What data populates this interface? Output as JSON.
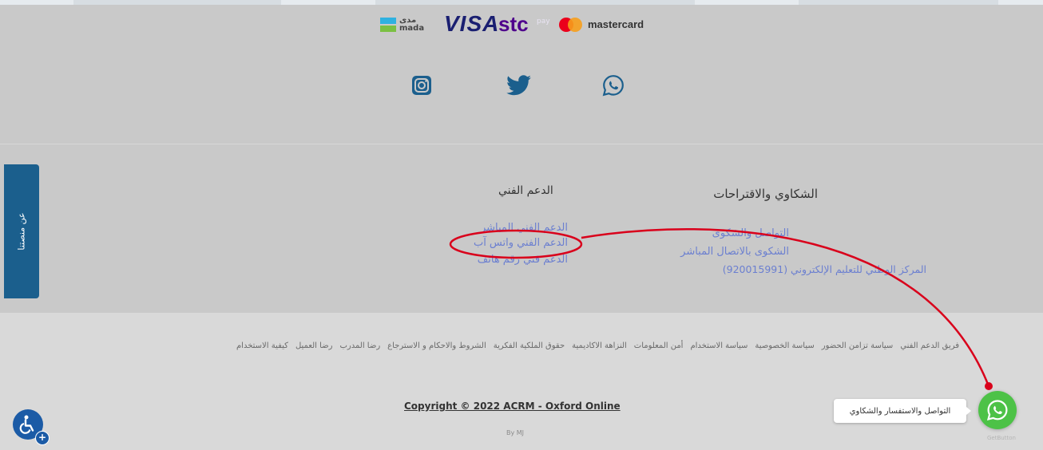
{
  "payments": {
    "mada_ar": "مدى",
    "mada_en": "mada",
    "visa": "VISA",
    "stc": "stc",
    "stc_pay": "pay",
    "mastercard": "mastercard"
  },
  "social": {
    "icons": [
      "instagram-icon",
      "twitter-icon",
      "whatsapp-icon"
    ],
    "color": "#1b5f8d"
  },
  "side_tab": {
    "label": "عن منصتنا"
  },
  "support": {
    "title": "الدعم الفني",
    "links": [
      "الدعم الفني المباشر",
      "الدعم الفني واتس آب",
      "الدعم فني رقم هاتف"
    ]
  },
  "complaints": {
    "title": "الشكاوي والاقتراحات",
    "links": [
      "التواصل والشكوى",
      "الشكوى بالاتصال المباشر",
      "المركز الوطني للتعليم الإلكتروني (920015991)"
    ]
  },
  "bottom_links": [
    "فريق الدعم الفني",
    "سياسة تزامن الحضور",
    "سياسة الخصوصية",
    "سياسة الاستخدام",
    "أمن المعلومات",
    "النزاهة الاكاديمية",
    "حقوق الملكية الفكرية",
    "الشروط والاحكام و الاسترجاع",
    "رضا المدرب",
    "رضا العميل",
    "كيفية الاستخدام"
  ],
  "footer": {
    "copyright": "Copyright © 2022 ACRM - Oxford Online",
    "byline": "By MJ"
  },
  "whatsapp_widget": {
    "bubble_text": "التواصل والاستفسار والشكاوي",
    "brand": "GetButton",
    "color": "#4dc247"
  },
  "colors": {
    "link": "#6b7fd0",
    "annotation": "#d9001b",
    "brand_blue": "#1b5f8d"
  }
}
